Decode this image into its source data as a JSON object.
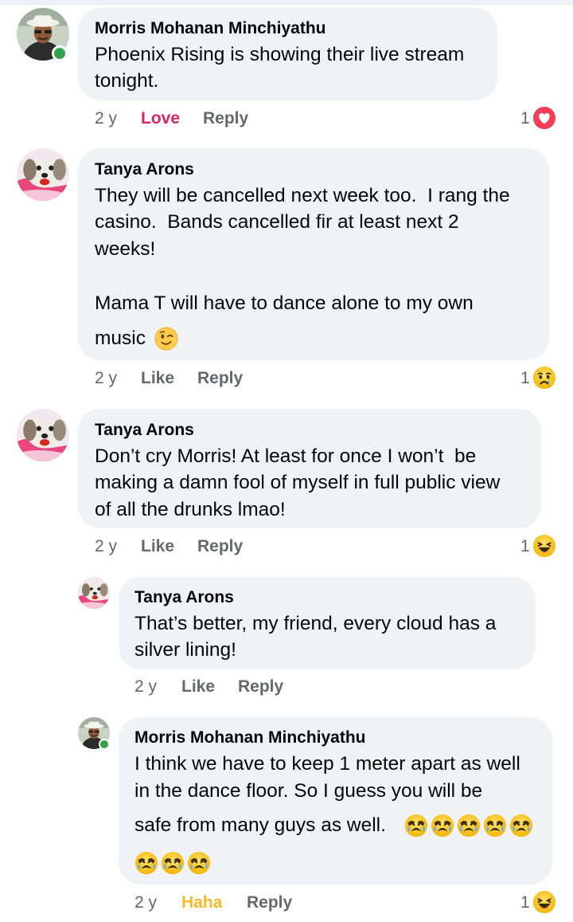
{
  "comments": [
    {
      "author": "Morris Mohanan Minchiyathu",
      "lines": [
        "Phoenix Rising is showing their live stream",
        "tonight."
      ],
      "age": "2 y",
      "action": "Love",
      "reply": "Reply",
      "reaction_count": "1",
      "reaction_icon": "love-icon"
    },
    {
      "author": "Tanya Arons",
      "lines": [
        "They will be cancelled next week too.  I rang the",
        "casino.  Bands cancelled fir at least next 2",
        "weeks!",
        "Mama T will have to dance alone to my own",
        "music"
      ],
      "age": "2 y",
      "action": "Like",
      "reply": "Reply",
      "reaction_count": "1",
      "reaction_icon": "sad-icon"
    },
    {
      "author": "Tanya Arons",
      "lines": [
        "Don’t cry Morris! At least for once I won’t  be",
        "making a damn fool of myself in full public view",
        "of all the drunks lmao!"
      ],
      "age": "2 y",
      "action": "Like",
      "reply": "Reply",
      "reaction_count": "1",
      "reaction_icon": "haha-icon"
    },
    {
      "author": "Tanya Arons",
      "lines": [
        "That’s better, my friend, every cloud has a",
        "silver lining!"
      ],
      "age": "2 y",
      "action": "Like",
      "reply": "Reply"
    },
    {
      "author": "Morris Mohanan Minchiyathu",
      "lines": [
        "I think we have to keep 1 meter apart as well",
        "in the dance floor. So I guess you will be",
        "safe from many guys as well."
      ],
      "age": "2 y",
      "action": "Haha",
      "reply": "Reply",
      "reaction_count": "1",
      "reaction_icon": "haha-icon"
    }
  ],
  "colors": {
    "bubble": "#f0f2f5",
    "meta_text": "#65676b",
    "love": "#e0245e",
    "haha": "#f7b928",
    "online": "#31a24c"
  }
}
